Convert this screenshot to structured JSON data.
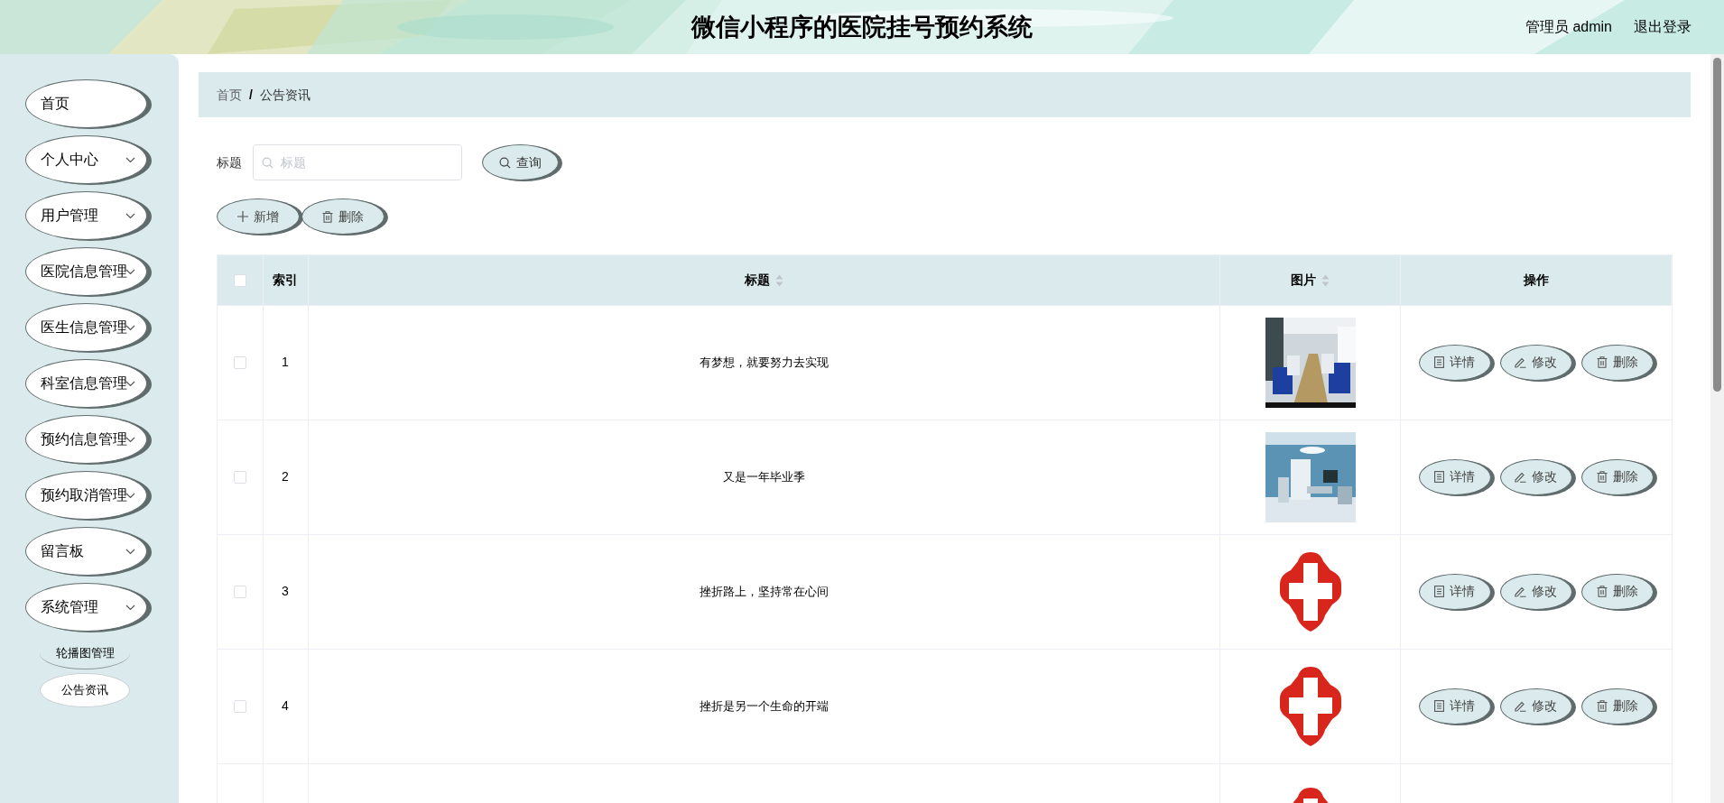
{
  "header": {
    "title": "微信小程序的医院挂号预约系统",
    "user": "管理员 admin",
    "logout": "退出登录"
  },
  "sidebar": {
    "items": [
      {
        "label": "首页",
        "kind": "link"
      },
      {
        "label": "个人中心",
        "kind": "group"
      },
      {
        "label": "用户管理",
        "kind": "group"
      },
      {
        "label": "医院信息管理",
        "kind": "group"
      },
      {
        "label": "医生信息管理",
        "kind": "group"
      },
      {
        "label": "科室信息管理",
        "kind": "group"
      },
      {
        "label": "预约信息管理",
        "kind": "group"
      },
      {
        "label": "预约取消管理",
        "kind": "group"
      },
      {
        "label": "留言板",
        "kind": "group"
      },
      {
        "label": "系统管理",
        "kind": "group",
        "children": [
          {
            "label": "轮播图管理",
            "selected": false
          },
          {
            "label": "公告资讯",
            "selected": true
          }
        ]
      }
    ]
  },
  "breadcrumb": [
    "首页",
    "/",
    "公告资讯"
  ],
  "search": {
    "label": "标题",
    "placeholder": "标题",
    "button": "查询"
  },
  "actions": [
    "新增",
    "删除"
  ],
  "table": {
    "header_checked": false,
    "columns": [
      {
        "label": "索引",
        "sortable": false
      },
      {
        "label": "标题",
        "sortable": true
      },
      {
        "label": "图片",
        "sortable": true
      },
      {
        "label": "操作",
        "sortable": false
      }
    ],
    "rows": [
      {
        "checked": false,
        "index": "1",
        "title": "有梦想，就要努力去实现",
        "image": {
          "kind": "picture"
        },
        "buttons": [
          "详情",
          "修改",
          "删除"
        ]
      },
      {
        "checked": false,
        "index": "2",
        "title": "又是一年毕业季",
        "image": {
          "kind": "picture"
        },
        "buttons": [
          "详情",
          "修改",
          "删除"
        ]
      },
      {
        "checked": false,
        "index": "3",
        "title": "挫折路上，坚持常在心间",
        "image": {
          "kind": "logo"
        },
        "buttons": [
          "详情",
          "修改",
          "删除"
        ]
      },
      {
        "checked": false,
        "index": "4",
        "title": "挫折是另一个生命的开端",
        "image": {
          "kind": "logo"
        },
        "buttons": [
          "详情",
          "修改",
          "删除"
        ]
      },
      {
        "image": {
          "kind": "logo"
        }
      }
    ]
  }
}
